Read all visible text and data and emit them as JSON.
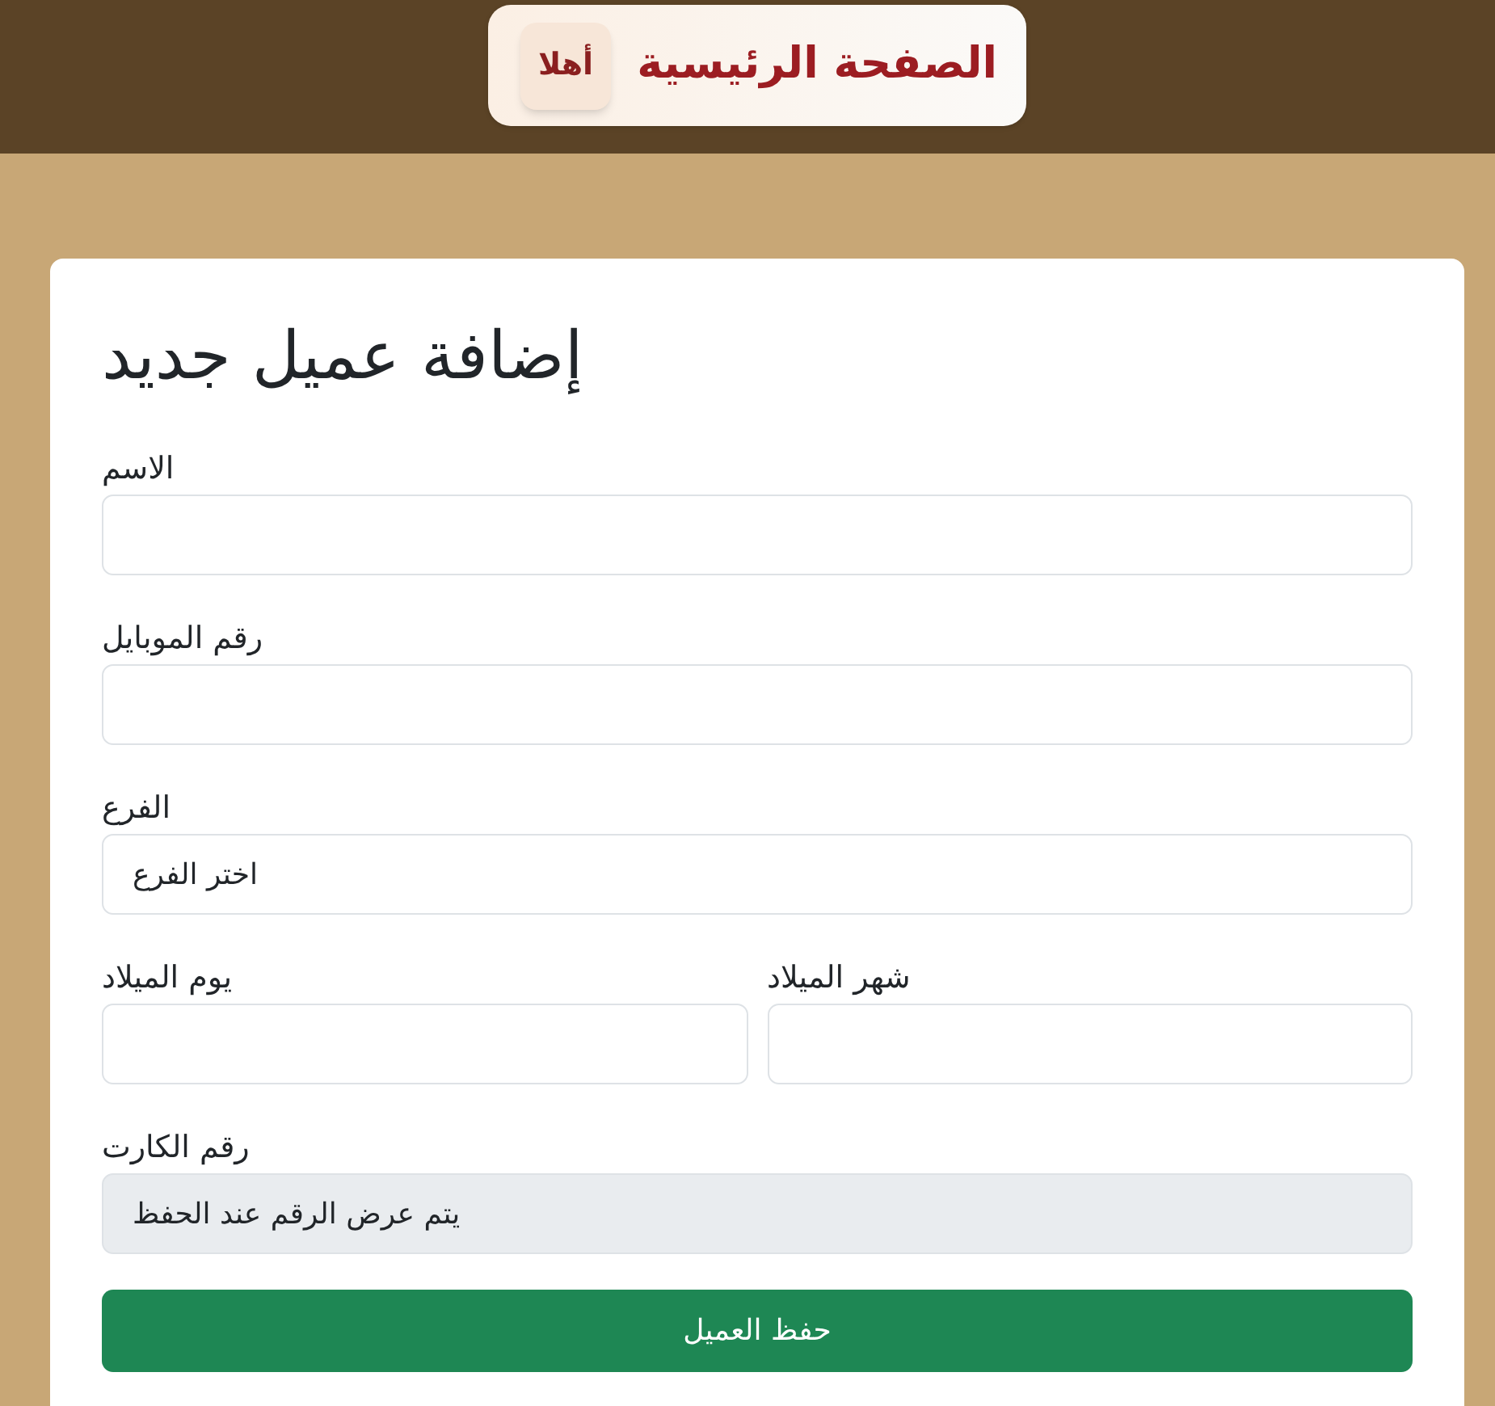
{
  "header": {
    "logo_text": "أهلا",
    "title": "الصفحة الرئيسية"
  },
  "form": {
    "title": "إضافة عميل جديد",
    "rows": [
      [
        {
          "label": "الاسم",
          "disabled": false
        }
      ],
      [
        {
          "label": "رقم الموبايل",
          "disabled": false
        }
      ],
      [
        {
          "label": "الفرع",
          "value": "اختر الفرع",
          "disabled": false
        }
      ],
      [
        {
          "label": "شهر الميلاد",
          "disabled": false
        },
        {
          "label": "يوم الميلاد",
          "disabled": false
        }
      ],
      [
        {
          "label": "رقم الكارت",
          "value": "يتم عرض الرقم عند الحفظ",
          "disabled": true
        }
      ]
    ],
    "submit": "حفظ العميل"
  }
}
